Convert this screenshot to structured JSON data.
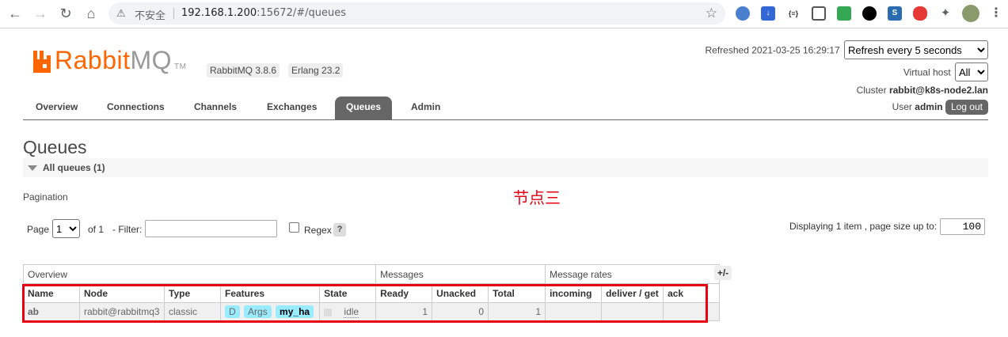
{
  "browser": {
    "insecure_label": "不安全",
    "url_host": "192.168.1.200",
    "url_rest": ":15672/#/queues"
  },
  "app": {
    "logo_main": "RabbitMQ",
    "logo_tm": "TM",
    "version_badge": "RabbitMQ 3.8.6",
    "erlang_badge": "Erlang 23.2"
  },
  "header": {
    "refreshed_label": "Refreshed 2021-03-25 16:29:17",
    "refresh_selected": "Refresh every 5 seconds",
    "vhost_label": "Virtual host",
    "vhost_selected": "All",
    "cluster_label": "Cluster",
    "cluster_name": "rabbit@k8s-node2.lan",
    "user_label": "User",
    "user_name": "admin",
    "logout_label": "Log out"
  },
  "tabs": [
    {
      "label": "Overview"
    },
    {
      "label": "Connections"
    },
    {
      "label": "Channels"
    },
    {
      "label": "Exchanges"
    },
    {
      "label": "Queues"
    },
    {
      "label": "Admin"
    }
  ],
  "page": {
    "title": "Queues",
    "section_title": "All queues (1)",
    "pagination_label": "Pagination",
    "annotation": "节点三"
  },
  "pagination": {
    "page_label": "Page",
    "page_selected": "1",
    "of_label": "of 1",
    "filter_label": "- Filter:",
    "regex_label": "Regex",
    "help_label": "?",
    "displaying_label": "Displaying 1 item , page size up to:",
    "page_size": "100"
  },
  "table": {
    "group_headers": {
      "overview": "Overview",
      "messages": "Messages",
      "message_rates": "Message rates"
    },
    "columns": [
      "Name",
      "Node",
      "Type",
      "Features",
      "State",
      "Ready",
      "Unacked",
      "Total",
      "incoming",
      "deliver / get",
      "ack"
    ],
    "plus_minus": "+/-",
    "rows": [
      {
        "name": "ab",
        "node": "rabbit@rabbitmq3",
        "type": "classic",
        "feature_d": "D",
        "feature_args": "Args",
        "feature_policy": "my_ha",
        "state": "idle",
        "ready": "1",
        "unacked": "0",
        "total": "1",
        "incoming": "",
        "deliver_get": "",
        "ack": ""
      }
    ]
  },
  "colors": {
    "brand_orange": "#ff6600",
    "annotation_red": "#e60012",
    "tab_active": "#666666"
  }
}
